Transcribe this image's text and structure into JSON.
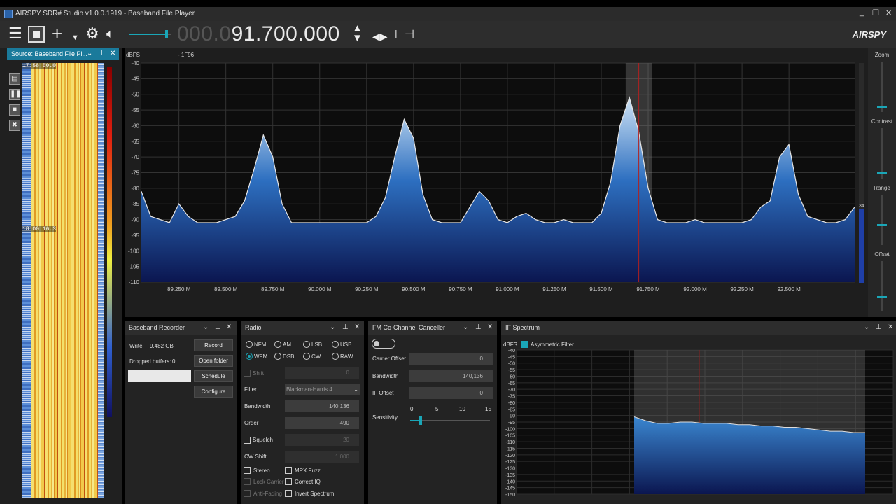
{
  "window": {
    "title": "AIRSPY SDR# Studio v1.0.0.1919 - Baseband File Player",
    "minimize": "_",
    "restore": "❐",
    "close": "✕"
  },
  "toolbar": {
    "frequency_dim": "000.0",
    "frequency_main": "91.700.000",
    "volume_fraction": 0.9,
    "logo": "AIRSPY"
  },
  "source_panel": {
    "title": "Source: Baseband File Pl...",
    "timestamp_top": "17:58:50.0",
    "timestamp_mid": "18:00:16.3"
  },
  "spectrum": {
    "unit_label": "dBFS",
    "center_label": "- 1F96",
    "y_ticks": [
      "-40",
      "-45",
      "-50",
      "-55",
      "-60",
      "-65",
      "-70",
      "-75",
      "-80",
      "-85",
      "-90",
      "-95",
      "-100",
      "-105",
      "-110"
    ],
    "x_ticks": [
      "89.250 M",
      "89.500 M",
      "89.750 M",
      "90.000 M",
      "90.250 M",
      "90.500 M",
      "90.750 M",
      "91.000 M",
      "91.250 M",
      "91.500 M",
      "91.750 M",
      "92.000 M",
      "92.250 M",
      "92.500 M"
    ],
    "level_readout": "34"
  },
  "chart_data": [
    {
      "type": "area",
      "title": "",
      "ylabel": "dBFS",
      "xlabel": "",
      "xlim": [
        89.05,
        92.85
      ],
      "ylim": [
        -110,
        -40
      ],
      "grid": true,
      "x": [
        89.05,
        89.1,
        89.15,
        89.2,
        89.25,
        89.3,
        89.35,
        89.4,
        89.45,
        89.5,
        89.55,
        89.6,
        89.65,
        89.7,
        89.75,
        89.8,
        89.85,
        89.9,
        89.95,
        90.0,
        90.05,
        90.1,
        90.15,
        90.2,
        90.25,
        90.3,
        90.35,
        90.4,
        90.45,
        90.5,
        90.55,
        90.6,
        90.65,
        90.7,
        90.75,
        90.8,
        90.85,
        90.9,
        90.95,
        91.0,
        91.05,
        91.1,
        91.15,
        91.2,
        91.25,
        91.3,
        91.35,
        91.4,
        91.45,
        91.5,
        91.55,
        91.6,
        91.65,
        91.7,
        91.75,
        91.8,
        91.85,
        91.9,
        91.95,
        92.0,
        92.05,
        92.1,
        92.15,
        92.2,
        92.25,
        92.3,
        92.35,
        92.4,
        92.45,
        92.5,
        92.55,
        92.6,
        92.65,
        92.7,
        92.75,
        92.8,
        92.85
      ],
      "values": [
        -81,
        -89,
        -90,
        -91,
        -85,
        -89,
        -91,
        -91,
        -91,
        -90,
        -89,
        -84,
        -74,
        -63,
        -70,
        -85,
        -91,
        -91,
        -91,
        -91,
        -91,
        -91,
        -91,
        -91,
        -91,
        -89,
        -83,
        -70,
        -58,
        -64,
        -82,
        -90,
        -91,
        -91,
        -91,
        -86,
        -81,
        -84,
        -90,
        -91,
        -89,
        -88,
        -90,
        -91,
        -91,
        -90,
        -91,
        -91,
        -91,
        -88,
        -78,
        -60,
        -51,
        -62,
        -80,
        -90,
        -91,
        -91,
        -91,
        -90,
        -91,
        -91,
        -91,
        -91,
        -91,
        -90,
        -86,
        -84,
        -70,
        -66,
        -82,
        -89,
        -90,
        -91,
        -91,
        -90,
        -86
      ],
      "highlight_band": [
        91.63,
        91.77
      ],
      "marker_x": 91.7
    },
    {
      "type": "area",
      "title": "IF Spectrum",
      "ylabel": "dBFS",
      "ylim": [
        -150,
        -40
      ],
      "grid": true,
      "x": [
        0,
        0.05,
        0.1,
        0.15,
        0.2,
        0.25,
        0.3,
        0.35,
        0.4,
        0.45,
        0.5,
        0.55,
        0.6,
        0.65,
        0.7,
        0.75,
        0.8,
        0.85,
        0.9,
        0.95,
        1.0
      ],
      "values": [
        -91,
        -94,
        -96,
        -96,
        -95,
        -95,
        -96,
        -96,
        -96,
        -97,
        -97,
        -98,
        -98,
        -99,
        -99,
        -100,
        -101,
        -102,
        -102,
        -103,
        -103
      ]
    }
  ],
  "zoom_panel": {
    "zoom": "Zoom",
    "contrast": "Contrast",
    "range": "Range",
    "offset": "Offset"
  },
  "baseband_recorder": {
    "title": "Baseband Recorder",
    "write_label": "Write:",
    "write_value": "9.482 GB",
    "dropped_label": "Dropped buffers:",
    "dropped_value": "0",
    "record": "Record",
    "open_folder": "Open folder",
    "schedule": "Schedule",
    "configure": "Configure"
  },
  "radio": {
    "title": "Radio",
    "modes": [
      "NFM",
      "AM",
      "LSB",
      "USB",
      "WFM",
      "DSB",
      "CW",
      "RAW"
    ],
    "selected_mode": "WFM",
    "shift_label": "Shift",
    "shift_value": "0",
    "filter_label": "Filter",
    "filter_value": "Blackman-Harris 4",
    "bandwidth_label": "Bandwidth",
    "bandwidth_value": "140,136",
    "order_label": "Order",
    "order_value": "490",
    "squelch_label": "Squelch",
    "squelch_value": "20",
    "cw_shift_label": "CW Shift",
    "cw_shift_value": "1,000",
    "stereo": "Stereo",
    "mpx_fuzz": "MPX Fuzz",
    "lock_carrier": "Lock Carrier",
    "correct_iq": "Correct IQ",
    "anti_fading": "Anti-Fading",
    "invert_spectrum": "Invert Spectrum"
  },
  "fm_canceller": {
    "title": "FM Co-Channel Canceller",
    "carrier_offset_label": "Carrier Offset",
    "carrier_offset_value": "0",
    "bandwidth_label": "Bandwidth",
    "bandwidth_value": "140,136",
    "if_offset_label": "IF Offset",
    "if_offset_value": "0",
    "sensitivity_label": "Sensitivity",
    "sensitivity_ticks": [
      "0",
      "5",
      "10",
      "15"
    ],
    "sensitivity_value": 2
  },
  "if_spectrum": {
    "title": "IF Spectrum",
    "unit_label": "dBFS",
    "asymmetric_filter": "Asymmetric Filter",
    "y_ticks": [
      "-40",
      "-45",
      "-50",
      "-55",
      "-60",
      "-65",
      "-70",
      "-75",
      "-80",
      "-85",
      "-90",
      "-95",
      "-100",
      "-105",
      "-110",
      "-115",
      "-120",
      "-125",
      "-130",
      "-135",
      "-140",
      "-145",
      "-150"
    ]
  }
}
